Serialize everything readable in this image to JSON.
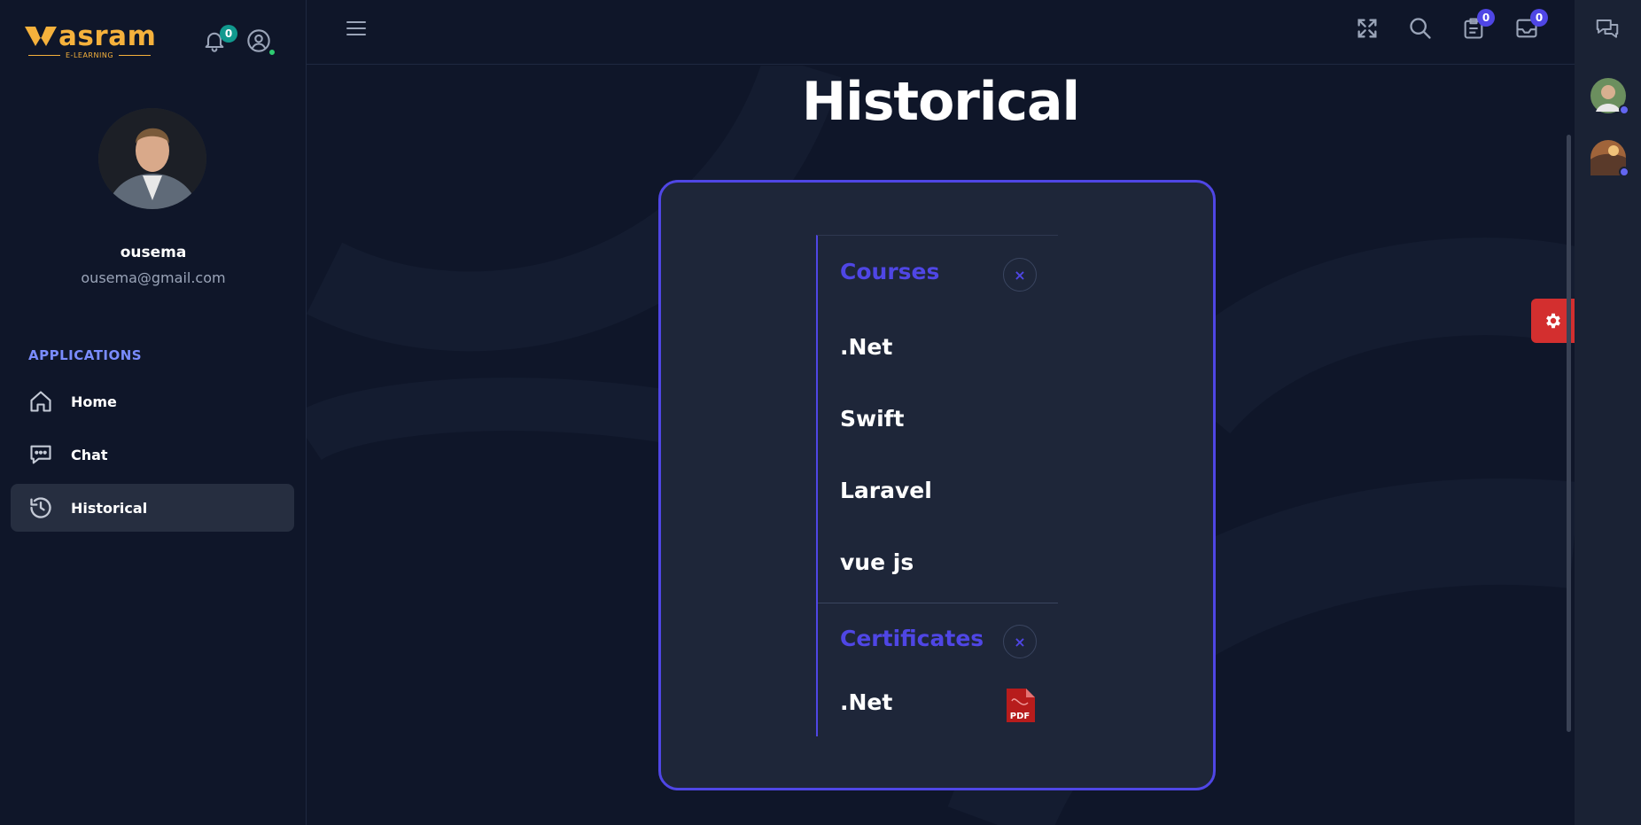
{
  "brand": {
    "name": "asram",
    "subtitle": "E-LEARNING",
    "color": "#f5b13c"
  },
  "topbar": {
    "notifications_count": "0"
  },
  "profile": {
    "name": "ousema",
    "email": "ousema@gmail.com"
  },
  "sidebar": {
    "section_label": "APPLICATIONS",
    "items": [
      {
        "label": "Home",
        "icon": "home-icon"
      },
      {
        "label": "Chat",
        "icon": "chat-icon"
      },
      {
        "label": "Historical",
        "icon": "history-icon",
        "active": true
      }
    ]
  },
  "header": {
    "icons": [
      "menu-icon",
      "fullscreen-icon",
      "search-icon",
      "clipboard-icon",
      "inbox-icon"
    ],
    "clipboard_count": "0",
    "inbox_count": "0"
  },
  "page": {
    "title": "Historical"
  },
  "history": {
    "courses_title": "Courses",
    "courses": [
      ".Net",
      "Swift",
      "Laravel",
      "vue js"
    ],
    "certificates_title": "Certificates",
    "certificates": [
      ".Net"
    ],
    "close_symbol": "×",
    "pdf_label": "PDF"
  },
  "colors": {
    "accent": "#4f46e5",
    "gear": "#d32f2f",
    "background": "#0f1629",
    "card": "#1e2639"
  }
}
